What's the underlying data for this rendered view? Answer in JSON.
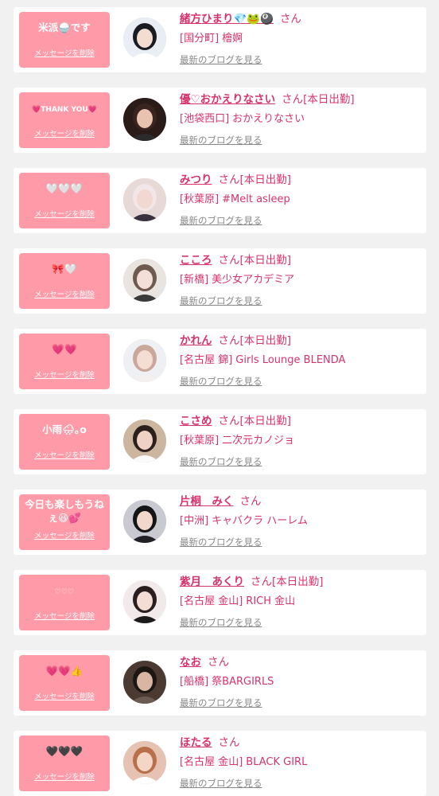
{
  "common": {
    "delete_label": "メッセージを削除",
    "blog_label": "最新のブログを見る",
    "san": "さん",
    "today_badge": "[本日出勤]"
  },
  "colors": {
    "message_box": "#ff9aa8",
    "name_text": "#d6336c",
    "card": "#ffffff",
    "background": "#f1f1f1"
  },
  "items": [
    {
      "message": "米派🍚です",
      "name": "緒方ひまり💎🐸🎱",
      "today": false,
      "area": "[国分町]",
      "shop": "檜婀"
    },
    {
      "message": "💗THANK YOU💗",
      "name": "優♡おかえりなさい",
      "today": true,
      "area": "[池袋西口]",
      "shop": "おかえりなさい"
    },
    {
      "message": "🤍🤍🤍",
      "name": "みつり",
      "today": true,
      "area": "[秋葉原]",
      "shop": "#Melt asleep"
    },
    {
      "message": "🎀🤍",
      "name": "こころ",
      "today": true,
      "area": "[新橋]",
      "shop": "美少女アカデミア"
    },
    {
      "message": "💗💗",
      "name": "かれん",
      "today": true,
      "area": "[名古屋 錦]",
      "shop": "Girls Lounge BLENDA"
    },
    {
      "message": "小雨🌧｡o",
      "name": "こさめ",
      "today": true,
      "area": "[秋葉原]",
      "shop": "二次元カノジョ"
    },
    {
      "message": "今日も楽しもうねぇ😆💕",
      "name": "片桐　みく",
      "today": false,
      "area": "[中洲]",
      "shop": "キャバクラ ハーレム"
    },
    {
      "message": "♡♡♡",
      "name": "紫月　あくり",
      "today": true,
      "area": "[名古屋 金山]",
      "shop": "RICH 金山"
    },
    {
      "message": "💗💗👍",
      "name": "なお",
      "today": false,
      "area": "[船橋]",
      "shop": "祭BARGIRLS"
    },
    {
      "message": "🖤🖤🖤",
      "name": "ほたる",
      "today": false,
      "area": "[名古屋 金山]",
      "shop": "BLACK GIRL"
    }
  ]
}
